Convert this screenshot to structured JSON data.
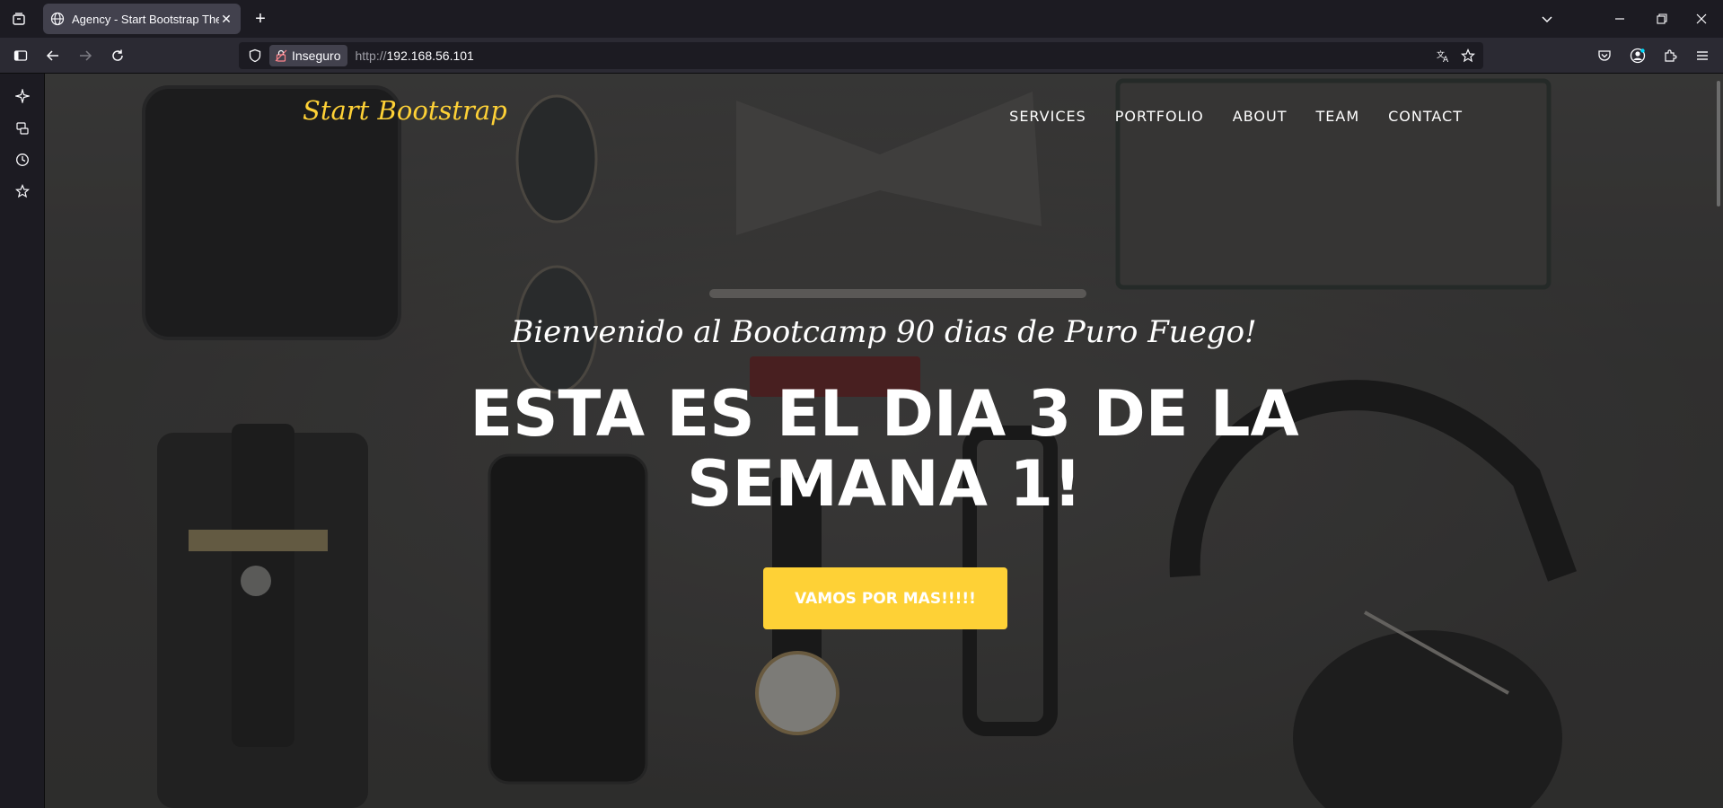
{
  "browser": {
    "tab_title": "Agency - Start Bootstrap Theme",
    "security_label": "Inseguro",
    "url_scheme": "http://",
    "url_host": "192.168.56.101"
  },
  "site": {
    "brand": "Start Bootstrap",
    "nav": [
      "SERVICES",
      "PORTFOLIO",
      "ABOUT",
      "TEAM",
      "CONTACT"
    ],
    "subheading": "Bienvenido al Bootcamp 90 dias de Puro Fuego!",
    "heading": "ESTA ES EL DIA 3 DE LA SEMANA 1!",
    "cta_label": "VAMOS POR MAS!!!!!"
  },
  "colors": {
    "accent": "#fed136",
    "chrome_bg": "#1c1b22",
    "toolbar_bg": "#2b2a33",
    "tab_active": "#42414d"
  },
  "icons": {
    "tab_list": "tab-list-icon",
    "tab_favicon": "globe-icon",
    "tab_close": "close-icon",
    "new_tab": "plus-icon",
    "sidebar_toggle": "sidebar-icon",
    "back": "back-arrow-icon",
    "forward": "forward-arrow-icon",
    "reload": "reload-icon",
    "shield": "shield-icon",
    "lock": "lock-icon",
    "translate": "translate-icon",
    "bookmark": "star-icon",
    "pocket": "pocket-icon",
    "account": "account-icon",
    "extensions": "puzzle-icon",
    "menu": "hamburger-icon",
    "side_ai": "ai-sparkle-icon",
    "side_synced": "synced-tabs-icon",
    "side_history": "history-icon",
    "side_bookmarks": "bookmarks-star-icon"
  }
}
